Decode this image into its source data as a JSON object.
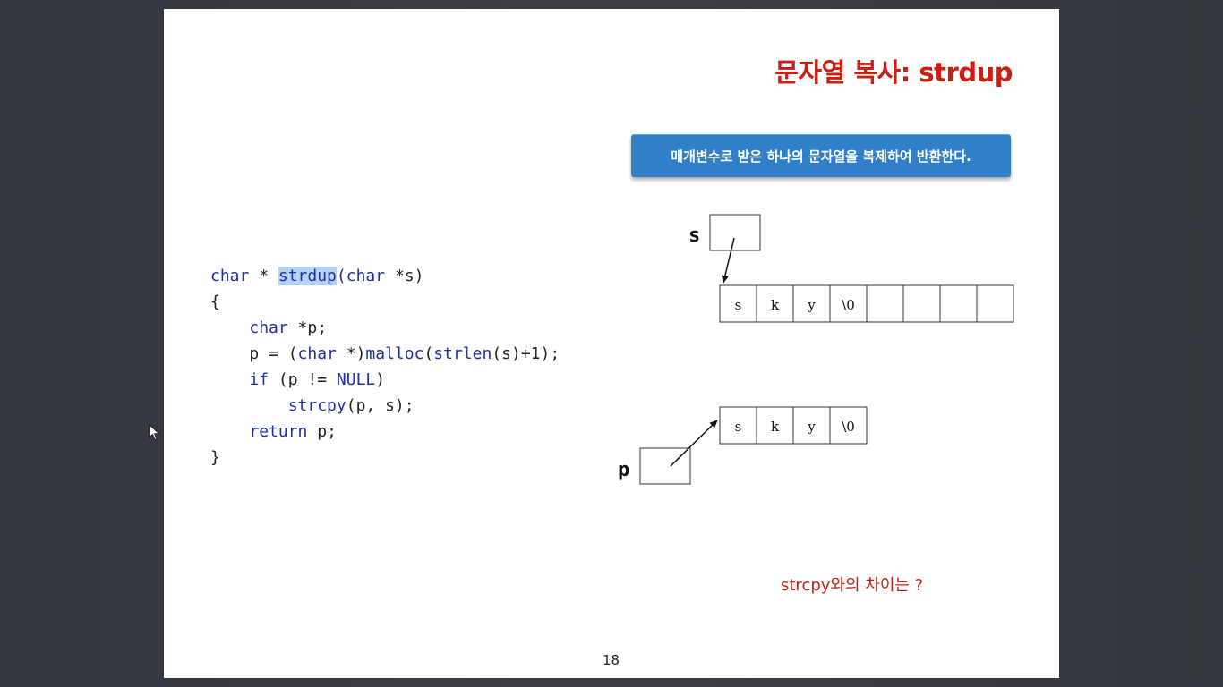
{
  "slide": {
    "title": "문자열 복사: strdup",
    "callout": "매개변수로 받은 하나의 문자열을 복제하여 반환한다.",
    "code": {
      "line1": {
        "kw1": "char",
        "mid": " * ",
        "fn": "strdup",
        "paren": "(",
        "kw2": "char",
        "rest": " *s)"
      },
      "line2": "{",
      "line3": {
        "indent": "    ",
        "kw": "char",
        "rest": " *p;"
      },
      "line4": {
        "a": "    p = (",
        "kw": "char",
        "b": " *)",
        "fn1": "malloc",
        "c": "(",
        "fn2": "strlen",
        "d": "(s)+1);"
      },
      "line5": {
        "indent": "    ",
        "kw": "if",
        "a": " (p != ",
        "kw2": "NULL",
        "b": ")"
      },
      "line6": {
        "indent": "        ",
        "fn": "strcpy",
        "rest": "(p, s);"
      },
      "line7": {
        "indent": "    ",
        "kw": "return",
        "rest": " p;"
      },
      "line8": "}"
    },
    "diagram": {
      "label_s": "s",
      "label_p": "p",
      "original_cells": [
        "s",
        "k",
        "y",
        "\\0",
        "",
        "",
        "",
        ""
      ],
      "copy_cells": [
        "s",
        "k",
        "y",
        "\\0"
      ]
    },
    "question": "strcpy와의 차이는 ?",
    "page_number": "18"
  }
}
